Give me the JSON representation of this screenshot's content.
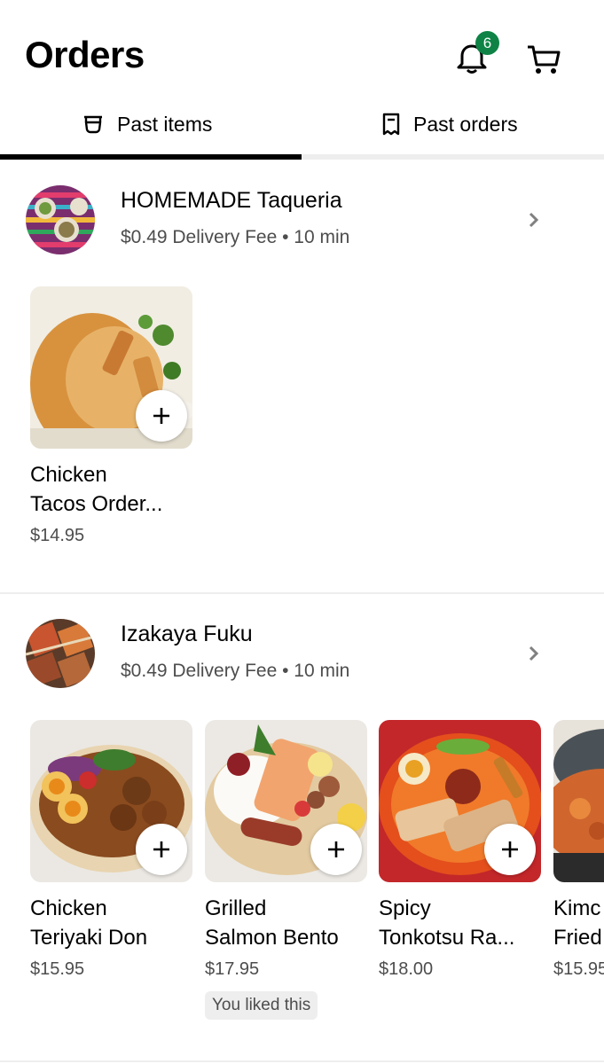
{
  "header": {
    "title": "Orders",
    "notification_count": "6"
  },
  "tabs": [
    {
      "label": "Past items",
      "active": true
    },
    {
      "label": "Past orders",
      "active": false
    }
  ],
  "stores": [
    {
      "name": "HOMEMADE Taqueria",
      "meta": "$0.49 Delivery Fee • 10 min",
      "items": [
        {
          "name_line1": "Chicken",
          "name_line2": "Tacos Order...",
          "price": "$14.95"
        }
      ]
    },
    {
      "name": "Izakaya Fuku",
      "meta": "$0.49 Delivery Fee • 10 min",
      "items": [
        {
          "name_line1": "Chicken",
          "name_line2": "Teriyaki Don",
          "price": "$15.95"
        },
        {
          "name_line1": "Grilled",
          "name_line2": "Salmon Bento",
          "price": "$17.95",
          "tag": "You liked this"
        },
        {
          "name_line1": "Spicy",
          "name_line2": "Tonkotsu Ra...",
          "price": "$18.00"
        },
        {
          "name_line1": "Kimc",
          "name_line2": "Fried",
          "price": "$15.95"
        }
      ]
    }
  ],
  "colors": {
    "badge": "#0e8345",
    "tab_active": "#000000",
    "divider": "#eeeeee"
  }
}
